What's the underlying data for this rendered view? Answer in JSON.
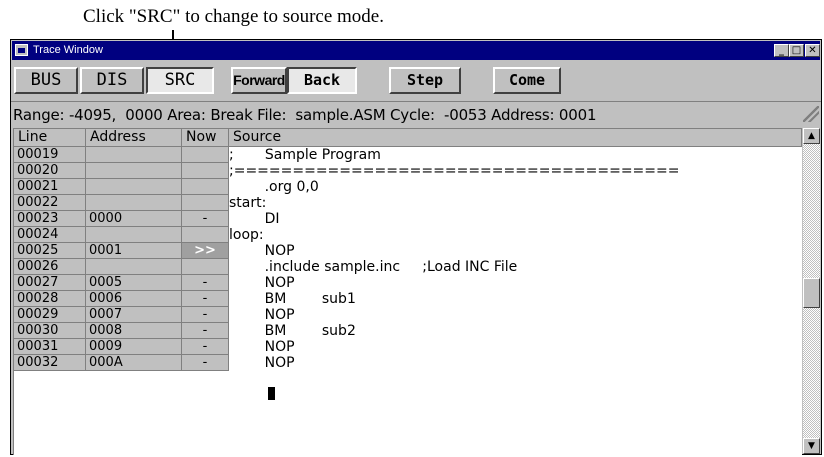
{
  "caption": "Click \"SRC\" to change to source mode.",
  "window": {
    "title": "Trace Window",
    "minimize": "_",
    "maximize": "□",
    "close": "✕"
  },
  "toolbar": {
    "bus": "BUS",
    "dis": "DIS",
    "src": "SRC",
    "forward": "Forward",
    "back": "Back",
    "step": "Step",
    "come": "Come"
  },
  "status": "Range: -4095,  0000 Area: Break File:  sample.ASM Cycle:  -0053 Address: 0001",
  "table": {
    "headers": {
      "line": "Line",
      "address": "Address",
      "now": "Now",
      "source": "Source"
    },
    "rows": [
      {
        "line": "00019",
        "address": "",
        "now": "",
        "source": ";       Sample Program"
      },
      {
        "line": "00020",
        "address": "",
        "now": "",
        "source": ";======================================"
      },
      {
        "line": "00021",
        "address": "",
        "now": "",
        "source": "        .org 0,0"
      },
      {
        "line": "00022",
        "address": "",
        "now": "",
        "source": "start:"
      },
      {
        "line": "00023",
        "address": "0000",
        "now": "-",
        "source": "        DI"
      },
      {
        "line": "00024",
        "address": "",
        "now": "",
        "source": "loop:"
      },
      {
        "line": "00025",
        "address": "0001",
        "now": ">>",
        "source": "        NOP"
      },
      {
        "line": "00026",
        "address": "",
        "now": "",
        "source": "        .include sample.inc     ;Load INC File"
      },
      {
        "line": "00027",
        "address": "0005",
        "now": "-",
        "source": "        NOP"
      },
      {
        "line": "00028",
        "address": "0006",
        "now": "-",
        "source": "        BM        sub1"
      },
      {
        "line": "00029",
        "address": "0007",
        "now": "-",
        "source": "        NOP"
      },
      {
        "line": "00030",
        "address": "0008",
        "now": "-",
        "source": "        BM        sub2"
      },
      {
        "line": "00031",
        "address": "0009",
        "now": "-",
        "source": "        NOP"
      },
      {
        "line": "00032",
        "address": "000A",
        "now": "-",
        "source": "        NOP"
      }
    ]
  },
  "scrollbar": {
    "up": "▲",
    "down": "▼"
  }
}
